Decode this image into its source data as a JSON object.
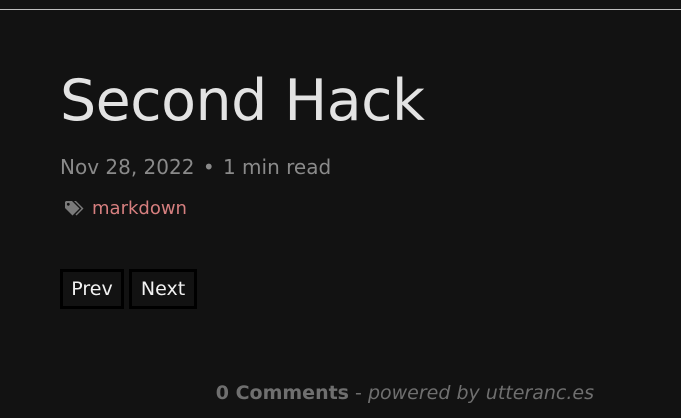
{
  "post": {
    "title": "Second Hack",
    "date": "Nov 28, 2022",
    "separator": "•",
    "read_time": "1 min read",
    "tags": [
      {
        "label": "markdown",
        "icon": "tags-icon"
      }
    ]
  },
  "pager": {
    "prev_label": "Prev",
    "next_label": "Next"
  },
  "comments": {
    "count_label": "0 Comments",
    "dash": "-",
    "powered_by": "powered by utteranc.es"
  },
  "colors": {
    "background": "#121212",
    "title": "#e3e3e3",
    "meta": "#8a8a8a",
    "tag": "#d67f7f",
    "button_border": "#000000"
  }
}
